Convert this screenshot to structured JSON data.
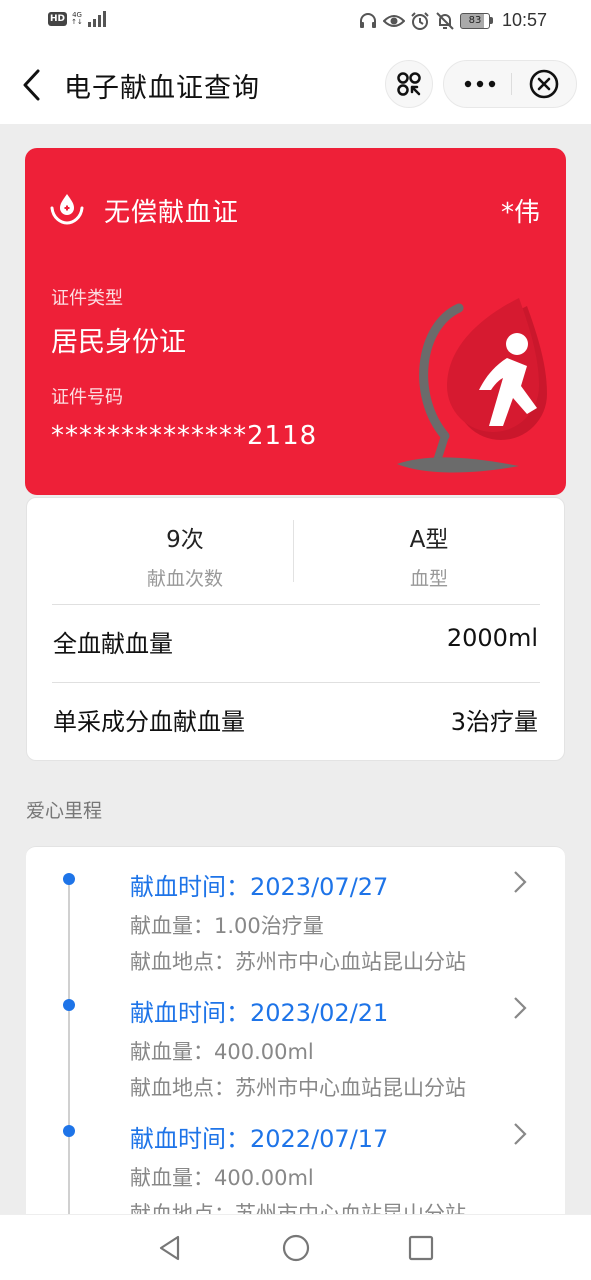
{
  "status_bar": {
    "hd": "HD",
    "network": "4G",
    "network_sub": "↑↓",
    "battery": "83",
    "time": "10:57"
  },
  "nav": {
    "title": "电子献血证查询"
  },
  "card": {
    "title": "无偿献血证",
    "name": "*伟",
    "id_type_label": "证件类型",
    "id_type": "居民身份证",
    "id_number_label": "证件号码",
    "id_number": "**************2118",
    "color": "#ee2038"
  },
  "stats": {
    "count_value": "9次",
    "count_label": "献血次数",
    "blood_type_value": "A型",
    "blood_type_label": "血型",
    "rows": [
      {
        "label": "全血献血量",
        "value": "2000ml"
      },
      {
        "label": "单采成分血献血量",
        "value": "3治疗量"
      }
    ]
  },
  "section": {
    "title": "爱心里程"
  },
  "records": [
    {
      "date": "献血时间：2023/07/27",
      "amount": "献血量：1.00治疗量",
      "place": "献血地点：苏州市中心血站昆山分站"
    },
    {
      "date": "献血时间：2023/02/21",
      "amount": "献血量：400.00ml",
      "place": "献血地点：苏州市中心血站昆山分站"
    },
    {
      "date": "献血时间：2022/07/17",
      "amount": "献血量：400.00ml",
      "place": "献血地点：苏州市中心血站昆山分站"
    }
  ],
  "icons": {
    "back": "back-arrow-icon",
    "scan": "scan-icon",
    "more": "more-icon",
    "close": "close-icon"
  },
  "accent_color": "#1e74e8"
}
